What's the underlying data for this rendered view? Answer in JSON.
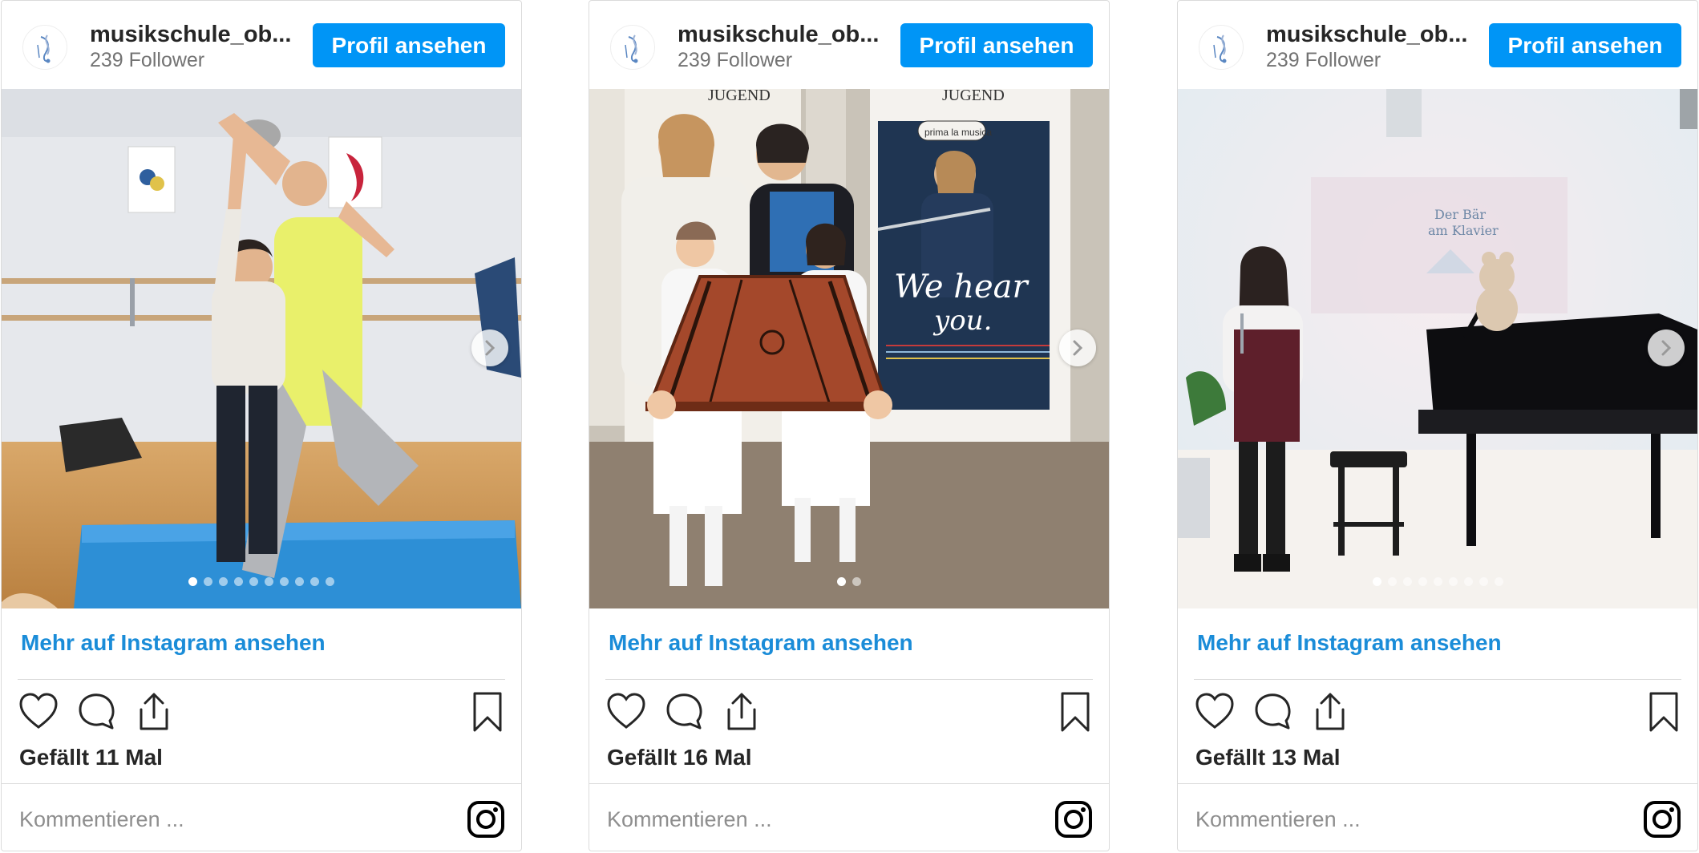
{
  "posts": [
    {
      "username": "musikschule_ob...",
      "followers": "239 Follower",
      "profile_button": "Profil ansehen",
      "more_link": "Mehr auf Instagram ansehen",
      "likes": "Gefällt 11 Mal",
      "comment_placeholder": "Kommentieren ...",
      "photo_icon": "dance-lesson-photo",
      "carousel_count": 10,
      "carousel_active": 1
    },
    {
      "username": "musikschule_ob...",
      "followers": "239 Follower",
      "profile_button": "Profil ansehen",
      "more_link": "Mehr auf Instagram ansehen",
      "likes": "Gefällt 16 Mal",
      "comment_placeholder": "Kommentieren ...",
      "photo_icon": "dulcimer-award-photo",
      "photo_text": {
        "banner_left": "JUGEND",
        "banner_right": "JUGEND",
        "brand": "prima la musica",
        "slogan_1": "We hear",
        "slogan_2": "you."
      },
      "carousel_count": 2,
      "carousel_active": 1
    },
    {
      "username": "musikschule_ob...",
      "followers": "239 Follower",
      "profile_button": "Profil ansehen",
      "more_link": "Mehr auf Instagram ansehen",
      "likes": "Gefällt 13 Mal",
      "comment_placeholder": "Kommentieren ...",
      "photo_icon": "piano-concert-photo",
      "photo_text": {
        "screen_1": "Der Bär",
        "screen_2": "am Klavier"
      },
      "carousel_count": 9,
      "carousel_active": 1
    }
  ],
  "colors": {
    "button_blue": "#0095f6",
    "link_blue": "#1a8cd8",
    "text_dark": "#262626",
    "text_muted": "#737373",
    "border": "#dbdbdb"
  },
  "icons": [
    "heart-icon",
    "comment-icon",
    "share-icon",
    "bookmark-icon",
    "instagram-icon",
    "chevron-right-icon",
    "music-school-logo"
  ]
}
